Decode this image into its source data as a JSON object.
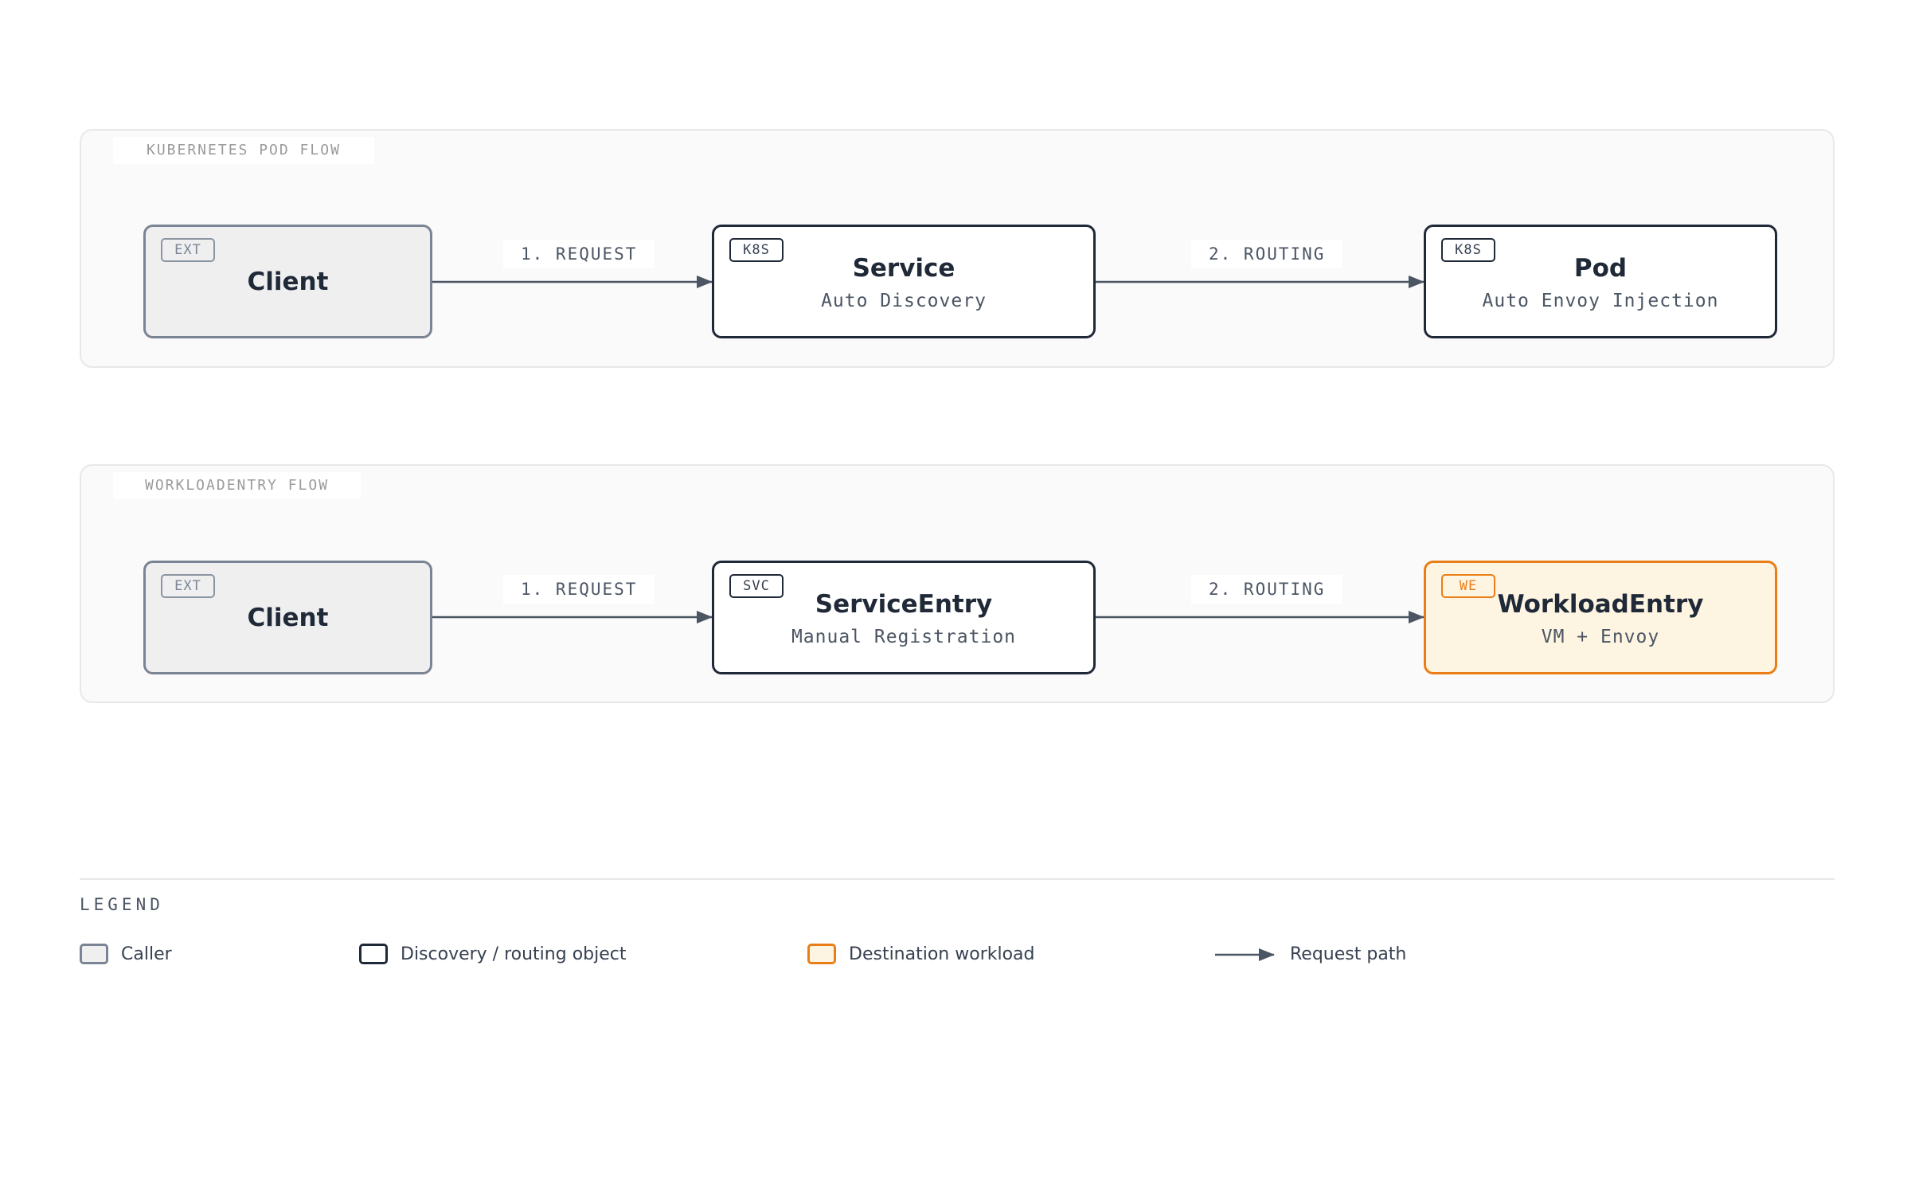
{
  "flows": [
    {
      "label": "KUBERNETES POD FLOW",
      "nodes": [
        {
          "badge": "EXT",
          "title": "Client",
          "subtitle": ""
        },
        {
          "badge": "K8S",
          "title": "Service",
          "subtitle": "Auto Discovery"
        },
        {
          "badge": "K8S",
          "title": "Pod",
          "subtitle": "Auto Envoy Injection"
        }
      ],
      "edges": [
        "1. REQUEST",
        "2. ROUTING"
      ]
    },
    {
      "label": "WORKLOADENTRY FLOW",
      "nodes": [
        {
          "badge": "EXT",
          "title": "Client",
          "subtitle": ""
        },
        {
          "badge": "SVC",
          "title": "ServiceEntry",
          "subtitle": "Manual Registration"
        },
        {
          "badge": "WE",
          "title": "WorkloadEntry",
          "subtitle": "VM + Envoy"
        }
      ],
      "edges": [
        "1. REQUEST",
        "2. ROUTING"
      ]
    }
  ],
  "legend": {
    "title": "LEGEND",
    "items": [
      {
        "label": "Caller"
      },
      {
        "label": "Discovery / routing object"
      },
      {
        "label": "Destination workload"
      },
      {
        "label": "Request path"
      }
    ]
  },
  "colors": {
    "caller_border": "#7a8494",
    "caller_fill": "#efefef",
    "route_border": "#1f2937",
    "dest_border": "#ea7e16",
    "dest_fill": "#fef4e2",
    "arrow": "#4b5563"
  }
}
